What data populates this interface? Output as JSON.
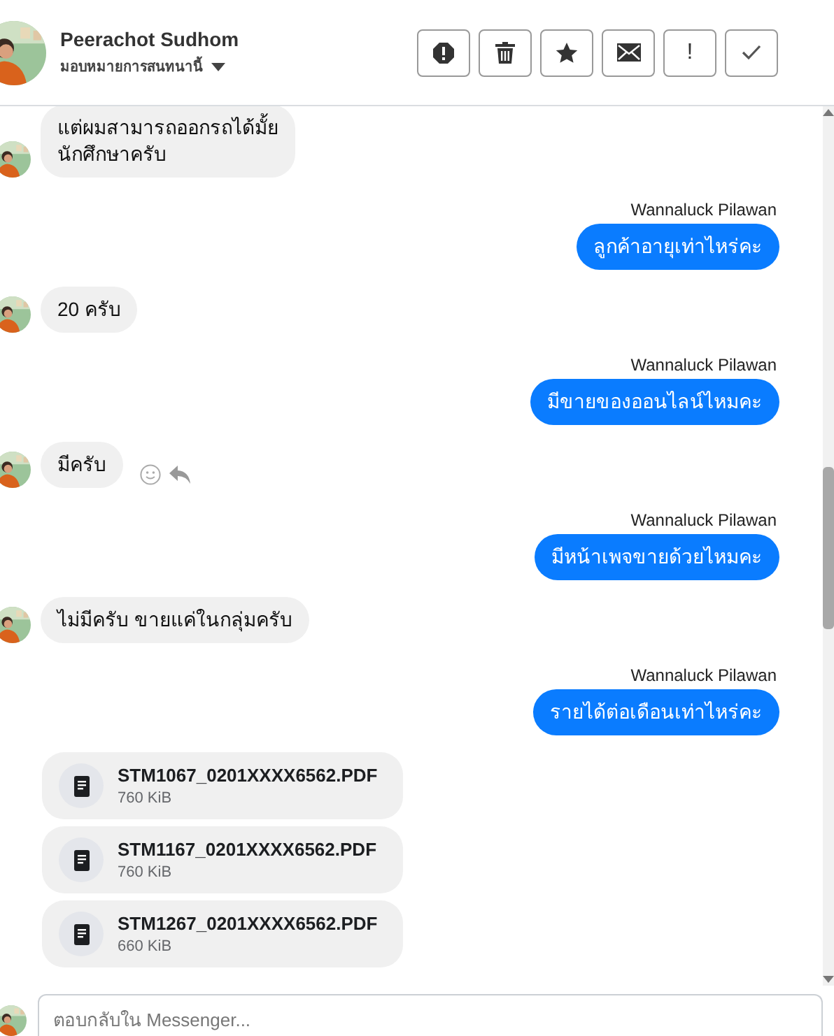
{
  "header": {
    "name": "Peerachot Sudhom",
    "subtitle": "มอบหมายการสนทนานี้",
    "buttons": [
      {
        "kind": "report"
      },
      {
        "kind": "delete"
      },
      {
        "kind": "star"
      },
      {
        "kind": "mail"
      },
      {
        "kind": "text",
        "label": "!"
      },
      {
        "kind": "done"
      }
    ]
  },
  "messages": [
    {
      "kind": "received",
      "text": "แต่ผมสามารถออกรถได้มั้ย\nนักศึกษาครับ",
      "actions_visible": false
    },
    {
      "kind": "sent",
      "sender": "Wannaluck Pilawan",
      "text": "ลูกค้าอายุเท่าไหร่คะ"
    },
    {
      "kind": "received",
      "text": "20 ครับ",
      "actions_visible": false
    },
    {
      "kind": "sent",
      "sender": "Wannaluck Pilawan",
      "text": "มีขายของออนไลน์ไหมคะ"
    },
    {
      "kind": "received",
      "text": "มีครับ",
      "actions_visible": true
    },
    {
      "kind": "sent",
      "sender": "Wannaluck Pilawan",
      "text": "มีหน้าเพจขายด้วยไหมคะ"
    },
    {
      "kind": "received",
      "text": "ไม่มีครับ ขายแค่ในกลุ่มครับ",
      "actions_visible": false
    },
    {
      "kind": "sent",
      "sender": "Wannaluck Pilawan",
      "text": "รายได้ต่อเดือนเท่าไหร่คะ"
    },
    {
      "kind": "file",
      "name": "STM1067_0201XXXX6562.PDF",
      "size": "760 KiB"
    },
    {
      "kind": "file",
      "name": "STM1167_0201XXXX6562.PDF",
      "size": "760 KiB"
    },
    {
      "kind": "file",
      "name": "STM1267_0201XXXX6562.PDF",
      "size": "660 KiB"
    }
  ],
  "composer": {
    "placeholder": "ตอบกลับใน Messenger..."
  }
}
